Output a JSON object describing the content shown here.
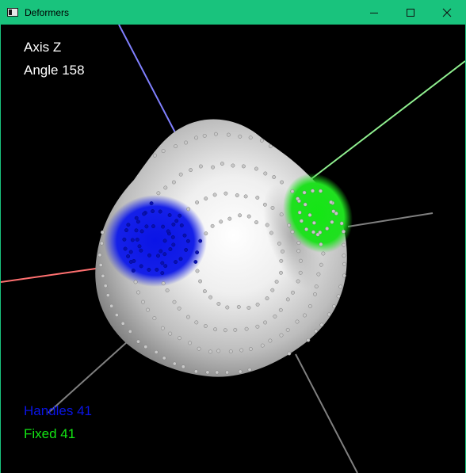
{
  "window": {
    "title": "Deformers",
    "accent": "#19c37d"
  },
  "titlebar_icons": [
    "app-window-icon",
    "minimize-icon",
    "maximize-icon",
    "close-icon"
  ],
  "hud": {
    "axis_label": "Axis Z",
    "angle_label": "Angle 158",
    "handles_label": "Handles 41",
    "fixed_label": "Fixed 41"
  },
  "colors": {
    "background": "#000000",
    "hud_text": "#ffffff",
    "handles": "#0a14e6",
    "fixed": "#14e614",
    "mesh": "#c8c8c8",
    "axis_x": "#ff7070",
    "axis_y": "#90f090",
    "axis_z": "#8080ff",
    "axis_neg": "#808080"
  }
}
